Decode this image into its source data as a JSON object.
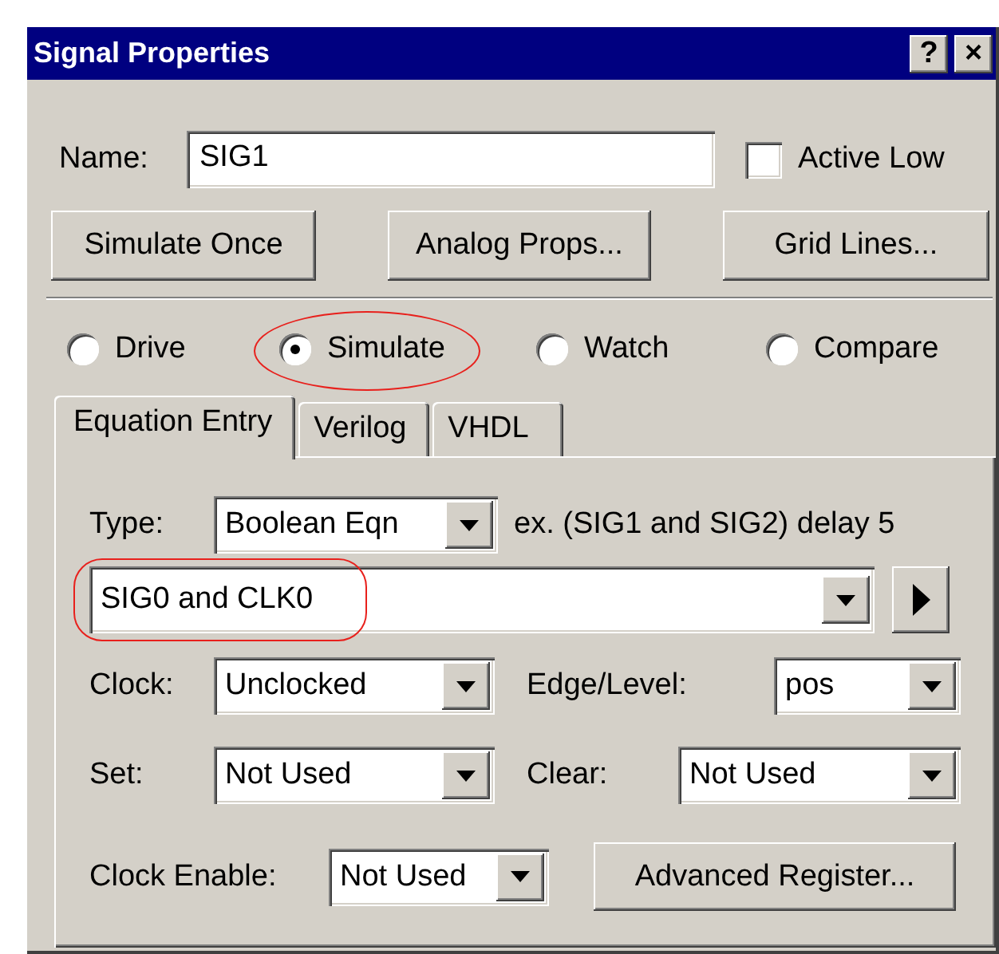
{
  "window": {
    "title": "Signal Properties",
    "buttons": [
      "?",
      "×"
    ]
  },
  "name_field": {
    "label": "Name:",
    "value": "SIG1"
  },
  "active_low": {
    "label": "Active Low",
    "checked": false
  },
  "buttons": [
    "Simulate Once",
    "Analog Props...",
    "Grid Lines..."
  ],
  "modes": [
    {
      "label": "Drive",
      "selected": false,
      "circled": false
    },
    {
      "label": "Simulate",
      "selected": true,
      "circled": true
    },
    {
      "label": "Watch",
      "selected": false,
      "circled": false
    },
    {
      "label": "Compare",
      "selected": false,
      "circled": false
    }
  ],
  "tabs": [
    {
      "label": "Equation Entry",
      "selected": true
    },
    {
      "label": "Verilog",
      "selected": false
    },
    {
      "label": "VHDL",
      "selected": false
    }
  ],
  "type_row": {
    "label": "Type:",
    "value": "Boolean Eqn",
    "hint": "ex. (SIG1 and SIG2) delay 5"
  },
  "equation": {
    "value": "SIG0 and CLK0",
    "circled": true
  },
  "fields": [
    {
      "label": "Clock:",
      "value": "Unclocked"
    },
    {
      "label": "Edge/Level:",
      "value": "pos"
    },
    {
      "label": "Set:",
      "value": "Not Used"
    },
    {
      "label": "Clear:",
      "value": "Not Used"
    },
    {
      "label": "Clock Enable:",
      "value": "Not Used"
    }
  ],
  "advanced_button": "Advanced Register..."
}
